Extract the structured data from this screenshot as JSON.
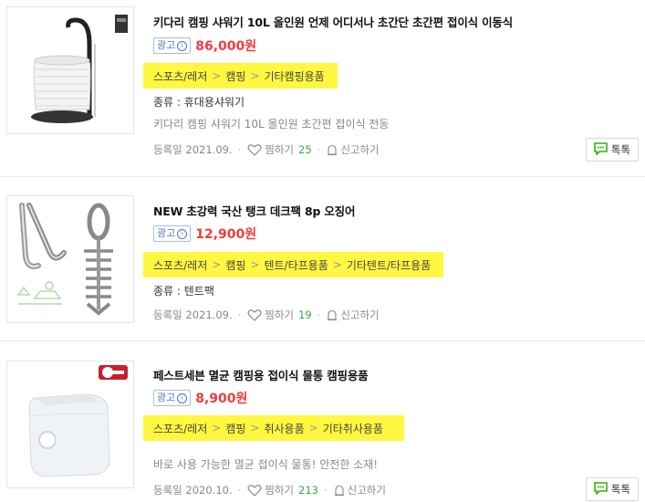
{
  "items": [
    {
      "title": "키다리 캠핑 샤워기 10L 올인원 언제 어디서나 초간단 초간편 접이식 이동식",
      "ad_label": "광고",
      "price": "86,000원",
      "categories": [
        "스포츠/레저",
        "캠핑",
        "기타캠핑용품"
      ],
      "spec": "종류 : 휴대용샤워기",
      "desc": "키다리 캠핑 샤워기 10L 올인원 초간편 접이식 전동",
      "reg_date": "등록일 2021.09.",
      "like_label": "찜하기",
      "like_count": "25",
      "report_label": "신고하기",
      "talk_label": "톡톡"
    },
    {
      "title": "NEW 초강력 국산 탱크 데크팩 8p 오징어",
      "ad_label": "광고",
      "price": "12,900원",
      "categories": [
        "스포츠/레저",
        "캠핑",
        "텐트/타프용품",
        "기타텐트/타프용품"
      ],
      "spec": "종류 : 텐트팩",
      "reg_date": "등록일 2021.09.",
      "like_label": "찜하기",
      "like_count": "19",
      "report_label": "신고하기"
    },
    {
      "title": "페스트세븐 멸균 캠핑용 접이식 물통 캠핑용품",
      "ad_label": "광고",
      "price": "8,900원",
      "categories": [
        "스포츠/레저",
        "캠핑",
        "취사용품",
        "기타취사용품"
      ],
      "desc": "바로 사용 가능한 멸균 접이식 물통! 안전한 소재!",
      "reg_date": "등록일 2020.10.",
      "like_label": "찜하기",
      "like_count": "213",
      "report_label": "신고하기",
      "talk_label": "톡톡"
    }
  ],
  "icons": {
    "info": "info-circle-icon",
    "like": "heart-icon",
    "report": "siren-icon",
    "talk": "chat-bubble-icon"
  },
  "colors": {
    "price": "#f03c3c",
    "highlight": "#fff740",
    "count": "#3aa845",
    "ad": "#4a78c7",
    "talk_icon": "#2db400"
  }
}
